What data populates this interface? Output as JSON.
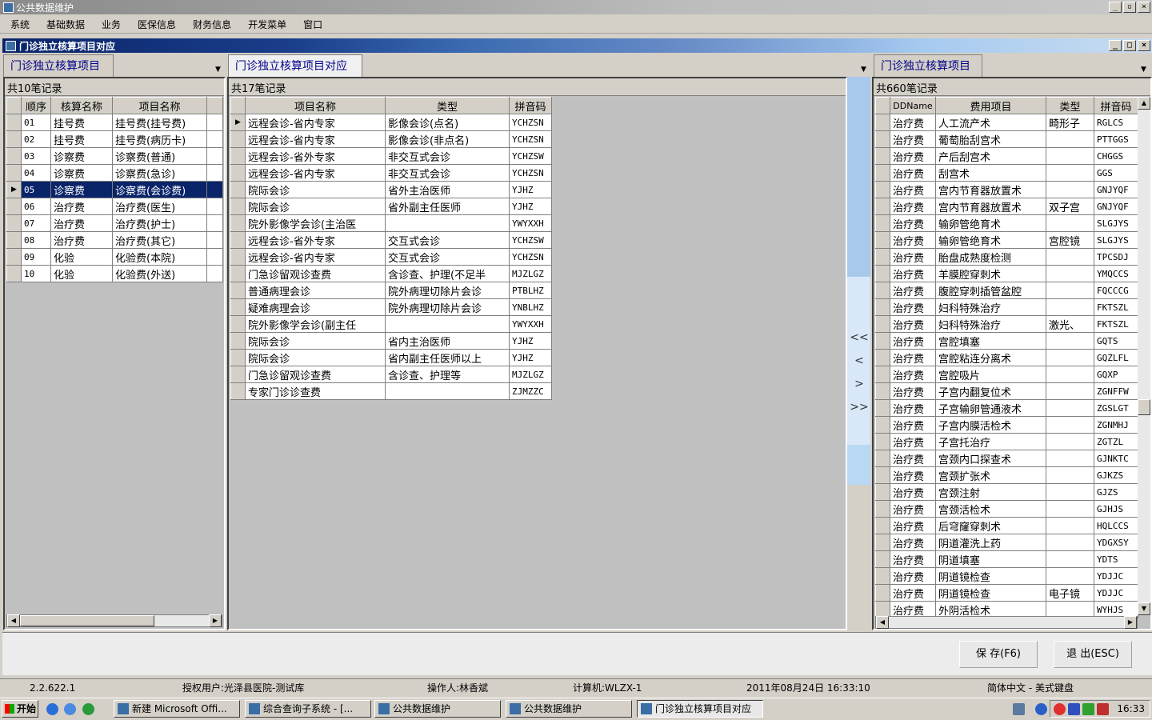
{
  "app": {
    "title": "公共数据维护"
  },
  "menu": [
    "系统",
    "基础数据",
    "业务",
    "医保信息",
    "财务信息",
    "开发菜单",
    "窗口"
  ],
  "child_window": {
    "title": "门诊独立核算项目对应"
  },
  "left": {
    "tab": "门诊独立核算项目",
    "record_count": "共10笔记录",
    "columns": [
      "顺序",
      "核算名称",
      "项目名称"
    ],
    "rows": [
      [
        "01",
        "挂号费",
        "挂号费(挂号费)"
      ],
      [
        "02",
        "挂号费",
        "挂号费(病历卡)"
      ],
      [
        "03",
        "诊察费",
        "诊察费(普通)"
      ],
      [
        "04",
        "诊察费",
        "诊察费(急诊)"
      ],
      [
        "05",
        "诊察费",
        "诊察费(会诊费)"
      ],
      [
        "06",
        "治疗费",
        "治疗费(医生)"
      ],
      [
        "07",
        "治疗费",
        "治疗费(护士)"
      ],
      [
        "08",
        "治疗费",
        "治疗费(其它)"
      ],
      [
        "09",
        "化验",
        "化验费(本院)"
      ],
      [
        "10",
        "化验",
        "化验费(外送)"
      ]
    ],
    "selected_row": 4
  },
  "middle": {
    "tab": "门诊独立核算项目对应",
    "record_count": "共17笔记录",
    "columns": [
      "项目名称",
      "类型",
      "拼音码"
    ],
    "rows": [
      [
        "远程会诊-省内专家",
        "影像会诊(点名)",
        "YCHZSN"
      ],
      [
        "远程会诊-省内专家",
        "影像会诊(非点名)",
        "YCHZSN"
      ],
      [
        "远程会诊-省外专家",
        "非交互式会诊",
        "YCHZSW"
      ],
      [
        "远程会诊-省内专家",
        "非交互式会诊",
        "YCHZSN"
      ],
      [
        "院际会诊",
        "省外主治医师",
        "YJHZ"
      ],
      [
        "院际会诊",
        "省外副主任医师",
        "YJHZ"
      ],
      [
        "院外影像学会诊(主治医",
        "",
        "YWYXXH"
      ],
      [
        "远程会诊-省外专家",
        "交互式会诊",
        "YCHZSW"
      ],
      [
        "远程会诊-省内专家",
        "交互式会诊",
        "YCHZSN"
      ],
      [
        "门急诊留观诊查费",
        "含诊查、护理(不足半",
        "MJZLGZ"
      ],
      [
        "普通病理会诊",
        "院外病理切除片会诊",
        "PTBLHZ"
      ],
      [
        "疑难病理会诊",
        "院外病理切除片会诊",
        "YNBLHZ"
      ],
      [
        "院外影像学会诊(副主任",
        "",
        "YWYXXH"
      ],
      [
        "院际会诊",
        "省内主治医师",
        "YJHZ"
      ],
      [
        "院际会诊",
        "省内副主任医师以上",
        "YJHZ"
      ],
      [
        "门急诊留观诊查费",
        "含诊查、护理等",
        "MJZLGZ"
      ],
      [
        "专家门诊诊查费",
        "",
        "ZJMZZC"
      ]
    ]
  },
  "arrows": [
    "<<",
    "<",
    ">",
    ">>"
  ],
  "right": {
    "tab": "门诊独立核算项目",
    "record_count": "共660笔记录",
    "columns": [
      "DDName",
      "费用项目",
      "类型",
      "拼音码"
    ],
    "rows": [
      [
        "治疗费",
        "人工流产术",
        "畸形子",
        "RGLCS"
      ],
      [
        "治疗费",
        "葡萄胎刮宫术",
        "",
        "PTTGGS"
      ],
      [
        "治疗费",
        "产后刮宫术",
        "",
        "CHGGS"
      ],
      [
        "治疗费",
        "刮宫术",
        "",
        "GGS"
      ],
      [
        "治疗费",
        "宫内节育器放置术",
        "",
        "GNJYQF"
      ],
      [
        "治疗费",
        "宫内节育器放置术",
        "双子宫",
        "GNJYQF"
      ],
      [
        "治疗费",
        "输卵管绝育术",
        "",
        "SLGJYS"
      ],
      [
        "治疗费",
        "输卵管绝育术",
        "宫腔镜",
        "SLGJYS"
      ],
      [
        "治疗费",
        "胎盘成熟度检测",
        "",
        "TPCSDJ"
      ],
      [
        "治疗费",
        "羊膜腔穿刺术",
        "",
        "YMQCCS"
      ],
      [
        "治疗费",
        "腹腔穿刺插管盆腔",
        "",
        "FQCCCG"
      ],
      [
        "治疗费",
        "妇科特殊治疗",
        "",
        "FKTSZL"
      ],
      [
        "治疗费",
        "妇科特殊治疗",
        "激光、",
        "FKTSZL"
      ],
      [
        "治疗费",
        "宫腔填塞",
        "",
        "GQTS"
      ],
      [
        "治疗费",
        "宫腔粘连分离术",
        "",
        "GQZLFL"
      ],
      [
        "治疗费",
        "宫腔吸片",
        "",
        "GQXP"
      ],
      [
        "治疗费",
        "子宫内翻复位术",
        "",
        "ZGNFFW"
      ],
      [
        "治疗费",
        "子宫输卵管通液术",
        "",
        "ZGSLGT"
      ],
      [
        "治疗费",
        "子宫内膜活检术",
        "",
        "ZGNMHJ"
      ],
      [
        "治疗费",
        "子宫托治疗",
        "",
        "ZGTZL"
      ],
      [
        "治疗费",
        "宫颈内口探查术",
        "",
        "GJNKTC"
      ],
      [
        "治疗费",
        "宫颈扩张术",
        "",
        "GJKZS"
      ],
      [
        "治疗费",
        "宫颈注射",
        "",
        "GJZS"
      ],
      [
        "治疗费",
        "宫颈活检术",
        "",
        "GJHJS"
      ],
      [
        "治疗费",
        "后穹窿穿刺术",
        "",
        "HQLCCS"
      ],
      [
        "治疗费",
        "阴道灌洗上药",
        "",
        "YDGXSY"
      ],
      [
        "治疗费",
        "阴道填塞",
        "",
        "YDTS"
      ],
      [
        "治疗费",
        "阴道镜检查",
        "",
        "YDJJC"
      ],
      [
        "治疗费",
        "阴道镜检查",
        "电子镜",
        "YDJJC"
      ],
      [
        "治疗费",
        "外阴活检术",
        "",
        "WYHJS"
      ]
    ]
  },
  "buttons": {
    "save": "保 存(F6)",
    "exit": "退 出(ESC)"
  },
  "status": {
    "version": "2.2.622.1",
    "user": "授权用户:光泽县医院-测试库",
    "operator": "操作人:林香斌",
    "computer": "计算机:WLZX-1",
    "datetime": "2011年08月24日 16:33:10",
    "ime": "简体中文 - 美式键盘"
  },
  "taskbar": {
    "start": "开始",
    "items": [
      "新建 Microsoft Offi...",
      "综合查询子系统 - [...",
      "公共数据维护",
      "公共数据维护",
      "门诊独立核算项目对应"
    ],
    "time": "16:33"
  }
}
